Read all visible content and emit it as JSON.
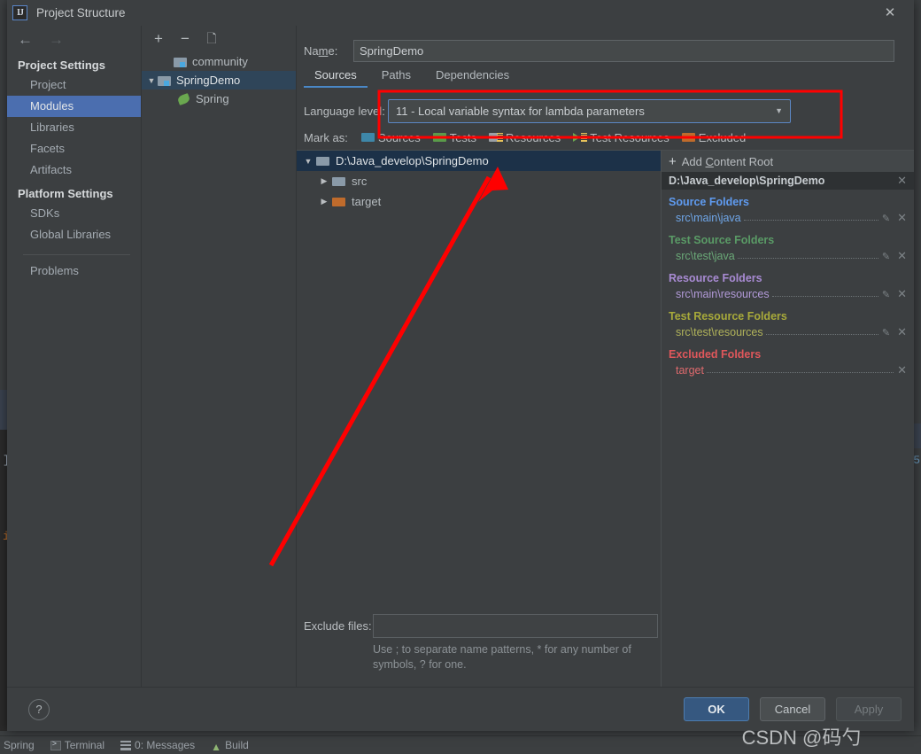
{
  "window": {
    "title": "Project Structure",
    "app_icon": "intellij-idea-icon",
    "close_icon": "close-icon"
  },
  "sidebar": {
    "back_icon": "arrow-left-icon",
    "forward_icon": "arrow-right-icon",
    "groups": [
      {
        "title": "Project Settings",
        "items": [
          {
            "label": "Project",
            "selected": false
          },
          {
            "label": "Modules",
            "selected": true
          },
          {
            "label": "Libraries",
            "selected": false
          },
          {
            "label": "Facets",
            "selected": false
          },
          {
            "label": "Artifacts",
            "selected": false
          }
        ]
      },
      {
        "title": "Platform Settings",
        "items": [
          {
            "label": "SDKs",
            "selected": false
          },
          {
            "label": "Global Libraries",
            "selected": false
          }
        ]
      }
    ],
    "problems_label": "Problems"
  },
  "modules_panel": {
    "toolbar": {
      "add_label": "+",
      "remove_label": "−",
      "copy_label": "copy-icon"
    },
    "tree": [
      {
        "label": "community",
        "type": "module",
        "expanded": null,
        "selected": false,
        "indent": 1
      },
      {
        "label": "SpringDemo",
        "type": "module",
        "expanded": true,
        "selected": true,
        "indent": 0
      },
      {
        "label": "Spring",
        "type": "facet",
        "expanded": null,
        "selected": false,
        "indent": 2
      }
    ]
  },
  "main": {
    "name_label": "Name:",
    "name_value": "SpringDemo",
    "tabs": [
      {
        "label": "Sources",
        "active": true
      },
      {
        "label": "Paths",
        "active": false
      },
      {
        "label": "Dependencies",
        "active": false
      }
    ],
    "language_level": {
      "label": "Language level:",
      "value": "11 - Local variable syntax for lambda parameters",
      "arrow_icon": "chevron-down-icon"
    },
    "mark_as": {
      "label": "Mark as:",
      "options": [
        {
          "label": "Sources",
          "color": "#3e87a8"
        },
        {
          "label": "Tests",
          "color": "#5a9b4a"
        },
        {
          "label": "Resources",
          "color": "#9aa0a6"
        },
        {
          "label": "Test Resources",
          "color": "#6aa84f"
        },
        {
          "label": "Excluded",
          "color": "#bf6b2c"
        }
      ]
    },
    "content_tree": [
      {
        "label": "D:\\Java_develop\\SpringDemo",
        "expanded": true,
        "selected": true,
        "color": "#8a9aa8",
        "indent": 0
      },
      {
        "label": "src",
        "expanded": false,
        "selected": false,
        "color": "#8a9aa8",
        "indent": 1
      },
      {
        "label": "target",
        "expanded": false,
        "selected": false,
        "color": "#bf6b2c",
        "indent": 1
      }
    ],
    "exclude_files": {
      "label": "Exclude files:",
      "value": "",
      "hint": "Use ; to separate name patterns, * for any number of symbols, ? for one."
    }
  },
  "roots_panel": {
    "add_content_root_label": "Add Content Root",
    "add_icon": "plus-icon",
    "root_path": "D:\\Java_develop\\SpringDemo",
    "root_remove_icon": "close-icon",
    "groups": [
      {
        "title": "Source Folders",
        "color": "#5f9bf0",
        "items": [
          {
            "path": "src\\main\\java",
            "has_edit": true,
            "has_remove": true
          }
        ]
      },
      {
        "title": "Test Source Folders",
        "color": "#5a9b66",
        "items": [
          {
            "path": "src\\test\\java",
            "has_edit": true,
            "has_remove": true
          }
        ]
      },
      {
        "title": "Resource Folders",
        "color": "#a98bd4",
        "items": [
          {
            "path": "src\\main\\resources",
            "has_edit": true,
            "has_remove": true
          }
        ]
      },
      {
        "title": "Test Resource Folders",
        "color": "#a8aa3a",
        "items": [
          {
            "path": "src\\test\\resources",
            "has_edit": true,
            "has_remove": true
          }
        ]
      },
      {
        "title": "Excluded Folders",
        "color": "#e0575b",
        "items": [
          {
            "path": "target",
            "has_edit": false,
            "has_remove": true
          }
        ]
      }
    ]
  },
  "footer": {
    "help_label": "?",
    "ok_label": "OK",
    "cancel_label": "Cancel",
    "apply_label": "Apply"
  },
  "background_ide": {
    "code_left_1": "]",
    "code_left_2": "i",
    "code_right_1": "5",
    "status_items": [
      {
        "label": "Spring",
        "icon": "spring-icon"
      },
      {
        "label": "Terminal",
        "icon": "terminal-icon"
      },
      {
        "label": "0: Messages",
        "icon": "messages-icon"
      },
      {
        "label": "Build",
        "icon": "build-icon"
      }
    ]
  },
  "annotations": {
    "watermark": "CSDN @码勺",
    "highlight_color": "#ff0000"
  }
}
